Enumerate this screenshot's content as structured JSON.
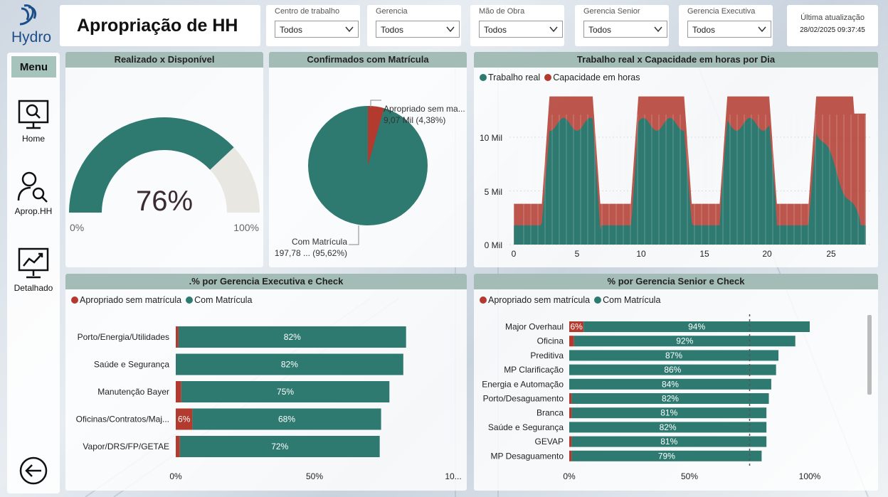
{
  "app": {
    "logo_text": "Hydro",
    "title": "Apropriação de HH"
  },
  "colors": {
    "teal": "#2e7a70",
    "red": "#b23a2e",
    "gauge_bg": "#e9e7e2",
    "header_band": "#a3bdb6"
  },
  "nav": {
    "menu_label": "Menu",
    "items": [
      {
        "label": "Home",
        "icon": "monitor-search-icon"
      },
      {
        "label": "Aprop.HH",
        "icon": "user-search-icon"
      },
      {
        "label": "Detalhado",
        "icon": "chart-board-icon"
      }
    ],
    "back_icon": "back-arrow-icon"
  },
  "filters": [
    {
      "label": "Centro de trabalho",
      "value": "Todos"
    },
    {
      "label": "Gerencia",
      "value": "Todos"
    },
    {
      "label": "Mão de Obra",
      "value": "Todos"
    },
    {
      "label": "Gerencia Senior",
      "value": "Todos"
    },
    {
      "label": "Gerencia Executiva",
      "value": "Todos"
    }
  ],
  "update": {
    "label": "Última atualização",
    "value": "28/02/2025 09:37:45"
  },
  "gauge": {
    "title": "Realizado x Disponível",
    "value_text": "76%",
    "value": 0.76,
    "min_label": "0%",
    "max_label": "100%"
  },
  "pie": {
    "title": "Confirmados com Matrícula",
    "slices": [
      {
        "name": "Apropriado sem ma...",
        "value_text": "9,07 Mil (4,38%)",
        "pct": 4.38
      },
      {
        "name": "Com Matrícula",
        "value_text": "197,78 ... (95,62%)",
        "pct": 95.62
      }
    ]
  },
  "area": {
    "title": "Trabalho real x Capacidade em horas por Dia",
    "legend": [
      "Trabalho real",
      "Capacidade em horas"
    ],
    "y_ticks": [
      "0 Mil",
      "5 Mil",
      "10 Mil"
    ],
    "x_ticks": [
      "0",
      "5",
      "10",
      "15",
      "20",
      "25"
    ]
  },
  "exec": {
    "title": ".% por Gerencia Executiva e Check",
    "legend": [
      "Apropriado sem matrícula",
      "Com Matrícula"
    ],
    "rows": [
      {
        "label": "Porto/Energia/Utilidades",
        "red": 1,
        "teal": 82,
        "pct_text": "82%",
        "red_text": ""
      },
      {
        "label": "Saúde e Segurança",
        "red": 0,
        "teal": 82,
        "pct_text": "82%",
        "red_text": ""
      },
      {
        "label": "Manutenção Bayer",
        "red": 2,
        "teal": 75,
        "pct_text": "75%",
        "red_text": ""
      },
      {
        "label": "Oficinas/Contratos/Maj...",
        "red": 6,
        "teal": 68,
        "pct_text": "68%",
        "red_text": "6%"
      },
      {
        "label": "Vapor/DRS/FP/GETAE",
        "red": 1.5,
        "teal": 72,
        "pct_text": "72%",
        "red_text": ""
      }
    ],
    "x_ticks": [
      "0%",
      "50%",
      "10..."
    ]
  },
  "senior": {
    "title": "% por Gerencia Senior e Check",
    "legend": [
      "Apropriado sem matrícula",
      "Com Matrícula"
    ],
    "rows": [
      {
        "label": "Major Overhaul",
        "red": 6,
        "teal": 94,
        "pct_text": "94%",
        "red_text": "6%"
      },
      {
        "label": "Oficina",
        "red": 2,
        "teal": 92,
        "pct_text": "92%",
        "red_text": ""
      },
      {
        "label": "Preditiva",
        "red": 0,
        "teal": 87,
        "pct_text": "87%",
        "red_text": ""
      },
      {
        "label": "MP Clarificação",
        "red": 0,
        "teal": 86,
        "pct_text": "86%",
        "red_text": ""
      },
      {
        "label": "Energia e Automação",
        "red": 0,
        "teal": 84,
        "pct_text": "84%",
        "red_text": ""
      },
      {
        "label": "Porto/Desaguamento",
        "red": 1,
        "teal": 82,
        "pct_text": "82%",
        "red_text": ""
      },
      {
        "label": "Branca",
        "red": 1,
        "teal": 81,
        "pct_text": "81%",
        "red_text": ""
      },
      {
        "label": "Saúde e Segurança",
        "red": 0,
        "teal": 82,
        "pct_text": "82%",
        "red_text": ""
      },
      {
        "label": "GEVAP",
        "red": 1,
        "teal": 81,
        "pct_text": "81%",
        "red_text": ""
      },
      {
        "label": "MP Desaguamento",
        "red": 1,
        "teal": 79,
        "pct_text": "79%",
        "red_text": ""
      }
    ],
    "x_ticks": [
      "0%",
      "50%",
      "100%"
    ]
  }
}
